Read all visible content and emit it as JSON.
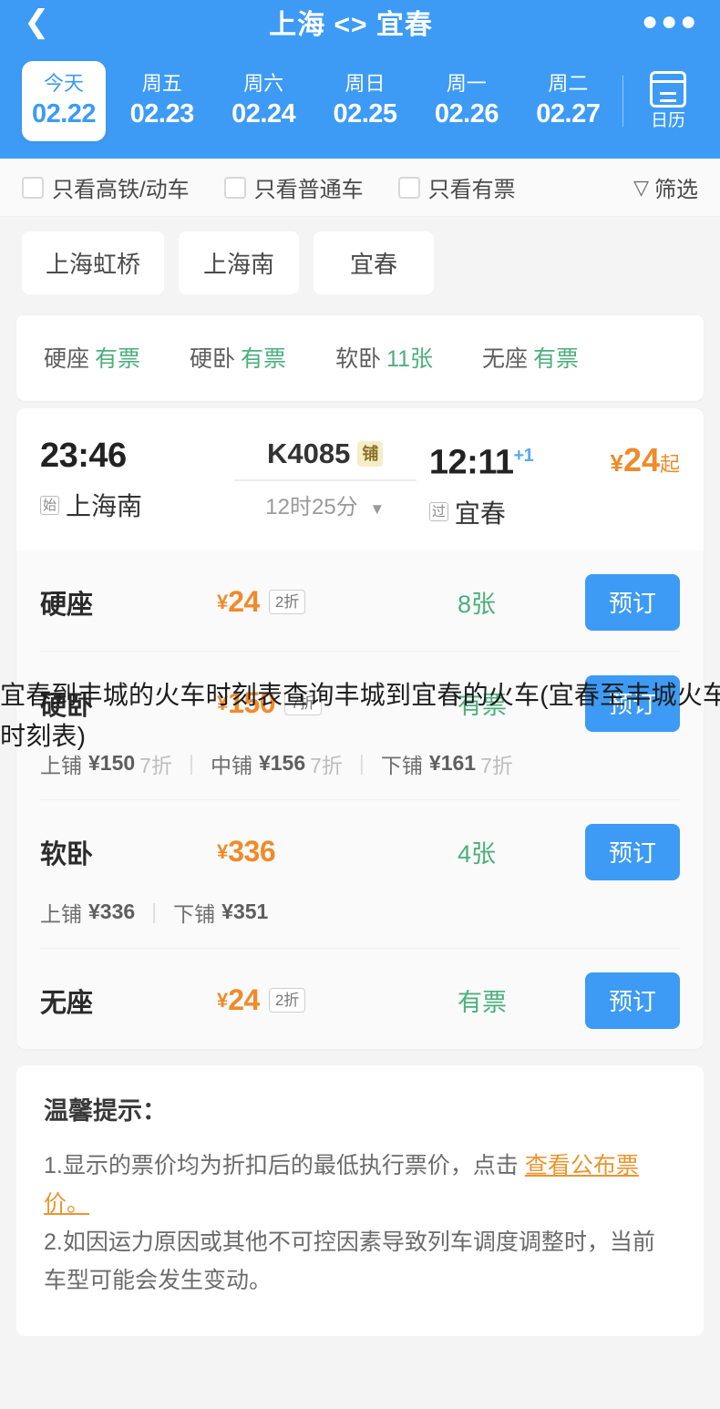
{
  "header": {
    "back_icon": "chevron-left",
    "title": "上海 <> 宜春",
    "more_icon": "ellipsis",
    "brand_color": "#3d9bf5",
    "dates": [
      {
        "week": "今天",
        "date": "02.22",
        "active": true
      },
      {
        "week": "周五",
        "date": "02.23",
        "active": false
      },
      {
        "week": "周六",
        "date": "02.24",
        "active": false
      },
      {
        "week": "周日",
        "date": "02.25",
        "active": false
      },
      {
        "week": "周一",
        "date": "02.26",
        "active": false
      },
      {
        "week": "周二",
        "date": "02.27",
        "active": false
      }
    ],
    "calendar_label": "日历"
  },
  "filters": {
    "options": [
      {
        "label": "只看高铁/动车",
        "checked": false
      },
      {
        "label": "只看普通车",
        "checked": false
      },
      {
        "label": "只看有票",
        "checked": false
      }
    ],
    "sort_label": "筛选",
    "sort_icon": "funnel-icon"
  },
  "station_chips": [
    {
      "label": "上海虹桥"
    },
    {
      "label": "上海南"
    },
    {
      "label": "宜春"
    }
  ],
  "availability": [
    {
      "label": "硬座",
      "value": "有票"
    },
    {
      "label": "硬卧",
      "value": "有票"
    },
    {
      "label": "软卧",
      "value": "11张"
    },
    {
      "label": "无座",
      "value": "有票"
    }
  ],
  "train": {
    "depart_time": "23:46",
    "depart_badge": "始",
    "depart_station": "上海南",
    "code": "K4085",
    "code_badge": "铺",
    "duration": "12时25分",
    "duration_caret": "chevron-down-icon",
    "arrive_time": "12:11",
    "arrive_day_offset": "+1",
    "arrive_badge": "过",
    "arrive_station": "宜春",
    "price_symbol": "¥",
    "price_amount": "24",
    "price_suffix": "起"
  },
  "seat_classes": [
    {
      "name": "硬座",
      "currency": "¥",
      "price": "24",
      "discount": "2折",
      "count": "8张",
      "button": "预订",
      "beds": []
    },
    {
      "name": "硬卧",
      "currency": "¥",
      "price": "150",
      "discount": "7折",
      "count": "有票",
      "button": "预订",
      "beds": [
        {
          "name": "上铺",
          "price": "¥150",
          "discount": "7折"
        },
        {
          "name": "中铺",
          "price": "¥156",
          "discount": "7折"
        },
        {
          "name": "下铺",
          "price": "¥161",
          "discount": "7折"
        }
      ]
    },
    {
      "name": "软卧",
      "currency": "¥",
      "price": "336",
      "discount": "",
      "count": "4张",
      "button": "预订",
      "beds": [
        {
          "name": "上铺",
          "price": "¥336",
          "discount": ""
        },
        {
          "name": "下铺",
          "price": "¥351",
          "discount": ""
        }
      ]
    },
    {
      "name": "无座",
      "currency": "¥",
      "price": "24",
      "discount": "2折",
      "count": "有票",
      "button": "预订",
      "beds": []
    }
  ],
  "tips": {
    "title": "温馨提示：",
    "line1_before": "1.显示的票价均为折扣后的最低执行票价，点击 ",
    "line1_link": "查看公布票价",
    "line1_after": "。",
    "line2": "2.如因运力原因或其他不可控因素导致列车调度调整时，当前车型可能会发生变动。"
  },
  "overlay": {
    "text": "宜春到丰城的火车时刻表查询丰城到宜春的火车(宜春至丰城火车时刻表)"
  },
  "colors": {
    "brand_blue": "#3d9bf5",
    "price_orange": "#f08a2a",
    "available_green": "#4caf7d",
    "link_orange": "#e8962f"
  }
}
